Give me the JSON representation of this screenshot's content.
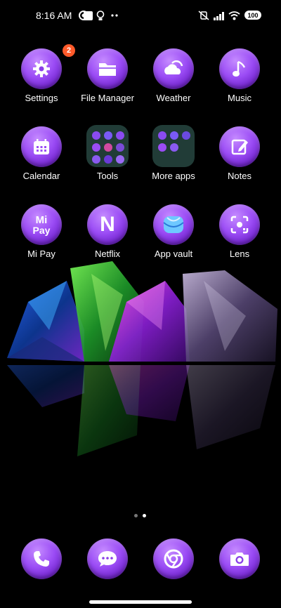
{
  "status_bar": {
    "time": "8:16 AM",
    "battery": "100",
    "left_icons": [
      "chrome-icon",
      "square-notification-icon",
      "bulb-icon",
      "more-icon"
    ],
    "right_icons": [
      "mute-vibrate-icon",
      "signal-icon",
      "wifi-icon",
      "battery-icon"
    ]
  },
  "apps": [
    {
      "label": "Settings",
      "icon": "gear-icon",
      "badge": "2"
    },
    {
      "label": "File Manager",
      "icon": "folder-icon"
    },
    {
      "label": "Weather",
      "icon": "cloud-sun-icon"
    },
    {
      "label": "Music",
      "icon": "music-note-icon"
    },
    {
      "label": "Calendar",
      "icon": "calendar-icon"
    },
    {
      "label": "Tools",
      "icon": "folder-grid-icon"
    },
    {
      "label": "More apps",
      "icon": "folder-grid-icon"
    },
    {
      "label": "Notes",
      "icon": "edit-note-icon"
    },
    {
      "label": "Mi Pay",
      "icon": "mi-pay-icon",
      "icon_text_top": "Mi",
      "icon_text_bottom": "Pay"
    },
    {
      "label": "Netflix",
      "icon": "netflix-icon",
      "icon_text": "N"
    },
    {
      "label": "App vault",
      "icon": "app-vault-icon"
    },
    {
      "label": "Lens",
      "icon": "lens-icon"
    }
  ],
  "page_indicator": {
    "pages": 2,
    "active": 2
  },
  "dock": [
    {
      "icon": "phone-icon"
    },
    {
      "icon": "messages-icon"
    },
    {
      "icon": "chrome-icon"
    },
    {
      "icon": "camera-icon"
    }
  ],
  "colors": {
    "accent": "#9b4cf5",
    "badge": "#ff5a2a",
    "background": "#000000"
  }
}
